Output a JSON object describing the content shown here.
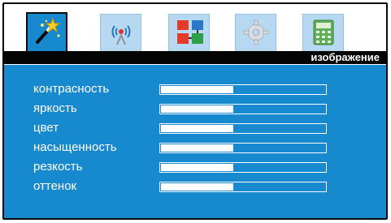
{
  "menu": {
    "header_title": "изображение",
    "active_tab": "picture",
    "tabs": [
      {
        "key": "picture",
        "icon": "magic-wand-icon"
      },
      {
        "key": "signal",
        "icon": "antenna-icon"
      },
      {
        "key": "channels",
        "icon": "network-blocks-icon"
      },
      {
        "key": "settings",
        "icon": "gear-icon"
      },
      {
        "key": "calculator",
        "icon": "calculator-icon"
      }
    ]
  },
  "settings": [
    {
      "label": "контрасность",
      "level": 0.44
    },
    {
      "label": "яркость",
      "level": 0.44
    },
    {
      "label": "цвет",
      "level": 0.44
    },
    {
      "label": "насыщенность",
      "level": 0.44
    },
    {
      "label": "резкость",
      "level": 0.44
    },
    {
      "label": "оттенок",
      "level": 0.44
    }
  ],
  "colors": {
    "panel": "#1789cf",
    "header": "#040404",
    "text": "#ffffff",
    "tab_inactive": "#b6d8f0"
  }
}
